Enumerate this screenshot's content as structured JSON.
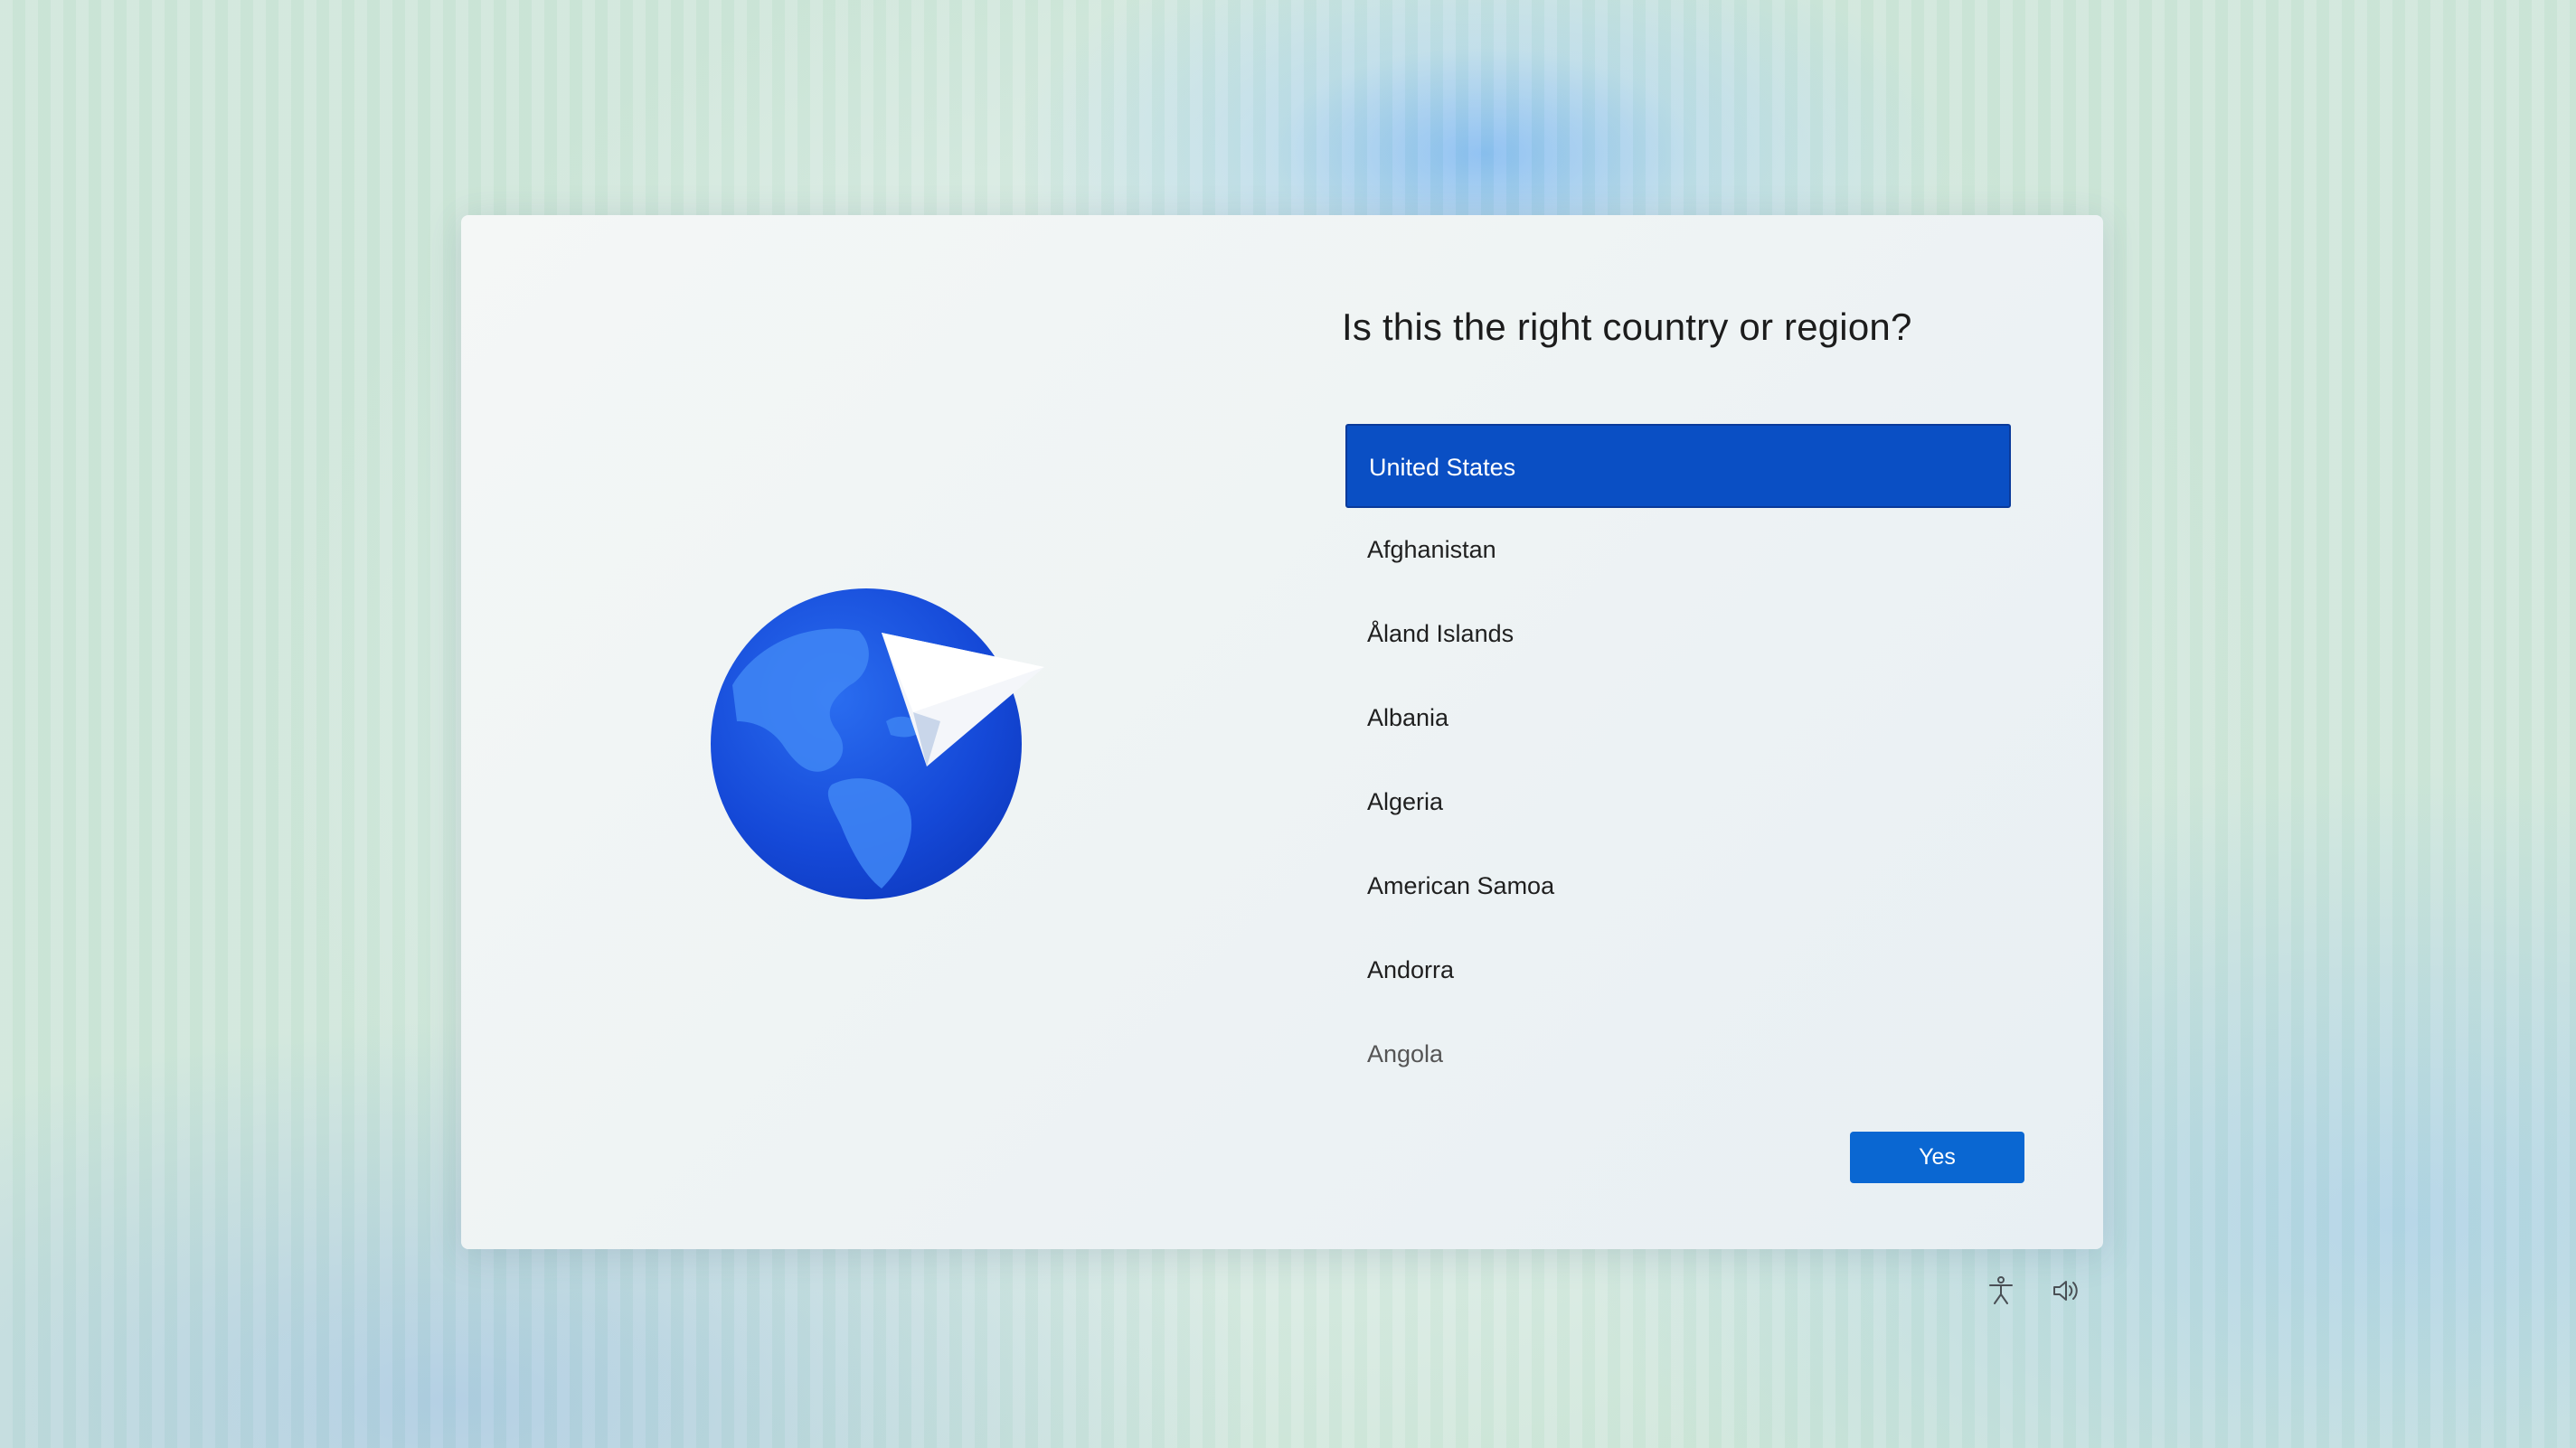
{
  "dialog": {
    "title": "Is this the right country or region?",
    "illustration_icon": "globe-with-paper-plane-icon",
    "countries": [
      {
        "label": "United States",
        "selected": true
      },
      {
        "label": "Afghanistan",
        "selected": false
      },
      {
        "label": "Åland Islands",
        "selected": false
      },
      {
        "label": "Albania",
        "selected": false
      },
      {
        "label": "Algeria",
        "selected": false
      },
      {
        "label": "American Samoa",
        "selected": false
      },
      {
        "label": "Andorra",
        "selected": false
      },
      {
        "label": "Angola",
        "selected": false
      }
    ],
    "confirm_label": "Yes"
  },
  "system_tray": {
    "icons": [
      "accessibility-icon",
      "volume-icon"
    ]
  },
  "colors": {
    "accent": "#0a4fc4",
    "button": "#0a67d2",
    "globe_blue": "#1450e0"
  }
}
